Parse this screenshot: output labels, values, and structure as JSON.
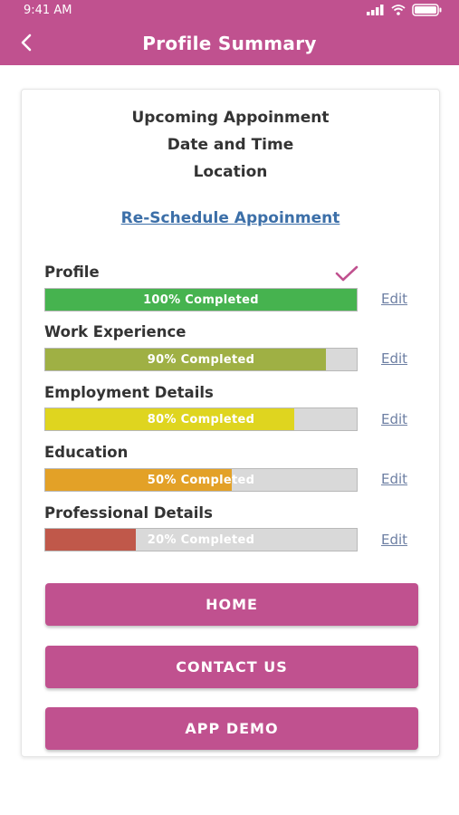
{
  "status_bar": {
    "time": "9:41 AM"
  },
  "nav": {
    "title": "Profile Summary"
  },
  "appointment": {
    "line1": "Upcoming Appoinment",
    "line2": "Date and Time",
    "line3": "Location",
    "reschedule_label": "Re-Schedule Appoinment"
  },
  "sections": [
    {
      "label": "Profile",
      "percent": 100,
      "status": "100% Completed",
      "color": "#46b34f",
      "edit_label": "Edit",
      "completed_check": true
    },
    {
      "label": "Work Experience",
      "percent": 90,
      "status": "90% Completed",
      "color": "#9fb044",
      "edit_label": "Edit"
    },
    {
      "label": "Employment Details",
      "percent": 80,
      "status": "80% Completed",
      "color": "#dfd51f",
      "edit_label": "Edit"
    },
    {
      "label": "Education",
      "percent": 60,
      "status": "50% Completed",
      "color": "#e3a127",
      "edit_label": "Edit"
    },
    {
      "label": "Professional Details",
      "percent": 29,
      "status": "20% Completed",
      "color": "#c0584a",
      "edit_label": "Edit"
    }
  ],
  "buttons": {
    "home": "HOME",
    "contact": "CONTACT US",
    "demo": "APP DEMO"
  },
  "colors": {
    "brand": "#c0518f",
    "link": "#3c6fa8",
    "check": "#c0518f"
  }
}
